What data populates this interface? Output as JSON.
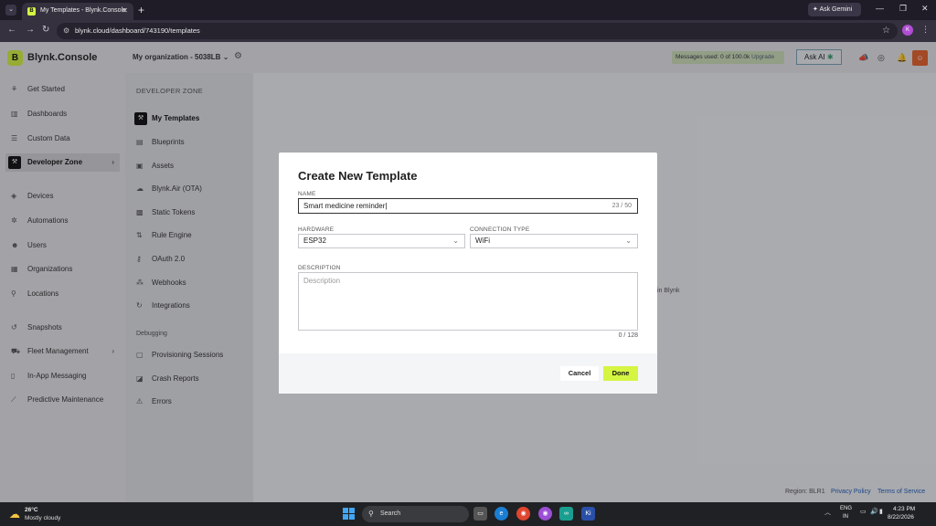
{
  "browser": {
    "tab_title": "My Templates - Blynk.Console",
    "tab_favicon": "B",
    "new_tab": "+",
    "ask_gemini": "Ask Gemini",
    "url": "blynk.cloud/dashboard/743190/templates",
    "profile_initial": "K"
  },
  "header": {
    "logo_letter": "B",
    "brand": "Blynk.Console",
    "org": "My organization - 5038LB",
    "messages_label": "Messages used: 0 of 100.0k",
    "messages_action": "Upgrade",
    "ask_ai": "Ask AI"
  },
  "sidebar": {
    "items": [
      {
        "label": "Get Started",
        "icon": "rocket-icon"
      },
      {
        "label": "Dashboards",
        "icon": "chart-icon"
      },
      {
        "label": "Custom Data",
        "icon": "database-icon"
      },
      {
        "label": "Developer Zone",
        "icon": "developer-icon"
      },
      {
        "label": "Devices",
        "icon": "cube-icon"
      },
      {
        "label": "Automations",
        "icon": "automation-icon"
      },
      {
        "label": "Users",
        "icon": "users-icon"
      },
      {
        "label": "Organizations",
        "icon": "building-icon"
      },
      {
        "label": "Locations",
        "icon": "pin-icon"
      },
      {
        "label": "Snapshots",
        "icon": "history-icon"
      },
      {
        "label": "Fleet Management",
        "icon": "fleet-icon"
      },
      {
        "label": "In-App Messaging",
        "icon": "message-icon"
      },
      {
        "label": "Predictive Maintenance",
        "icon": "trend-icon"
      }
    ]
  },
  "devzone": {
    "title": "DEVELOPER ZONE",
    "items": [
      {
        "label": "My Templates"
      },
      {
        "label": "Blueprints"
      },
      {
        "label": "Assets"
      },
      {
        "label": "Blynk.Air (OTA)"
      },
      {
        "label": "Static Tokens"
      },
      {
        "label": "Rule Engine"
      },
      {
        "label": "OAuth 2.0"
      },
      {
        "label": "Webhooks"
      },
      {
        "label": "Integrations"
      }
    ],
    "debug_title": "Debugging",
    "debug_items": [
      {
        "label": "Provisioning Sessions"
      },
      {
        "label": "Crash Reports"
      },
      {
        "label": "Errors"
      }
    ]
  },
  "main": {
    "partial_text": "in Blynk"
  },
  "footer": {
    "region": "Region: BLR1",
    "privacy": "Privacy Policy",
    "terms": "Terms of Service"
  },
  "modal": {
    "title": "Create New Template",
    "name_label": "NAME",
    "name_value": "Smart medicine reminder",
    "name_counter": "23 / 50",
    "hardware_label": "HARDWARE",
    "hardware_value": "ESP32",
    "connection_label": "CONNECTION TYPE",
    "connection_value": "WiFi",
    "description_label": "DESCRIPTION",
    "description_placeholder": "Description",
    "description_counter": "0 / 128",
    "cancel": "Cancel",
    "done": "Done"
  },
  "taskbar": {
    "temperature": "26°C",
    "weather": "Mostly cloudy",
    "search": "Search",
    "lang1": "ENG",
    "lang2": "IN",
    "time": "4:23 PM",
    "date": "8/22/2026"
  },
  "colors": {
    "accent": "#d4f542",
    "modal_bg": "#ffffff",
    "sidebar_bg": "#e7e8ea",
    "link": "#1f5fbf"
  }
}
